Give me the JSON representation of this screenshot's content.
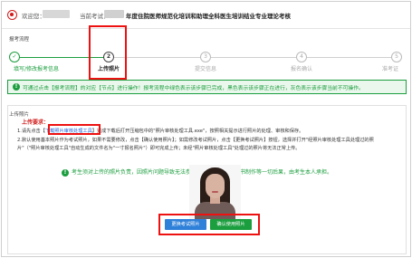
{
  "header": {
    "welcome_label": "欢迎您：",
    "exam_label": "当前考试：",
    "exam_title": "年度住院医师规范化培训和助理全科医生培训结业专业理论考核"
  },
  "process": {
    "section_title": "报考流程",
    "steps": [
      {
        "number": "✓",
        "label": "填写/修改报考信息",
        "state": "done"
      },
      {
        "number": "2",
        "label": "上传照片",
        "state": "active"
      },
      {
        "number": "3",
        "label": "提交信息",
        "state": "pending"
      },
      {
        "number": "4",
        "label": "报名确认",
        "state": "pending"
      },
      {
        "number": "5",
        "label": "准考证",
        "state": "pending"
      }
    ],
    "notice_icon": "info-icon",
    "notice": "可通过点击【报考流程】的对应【节点】进行操作！报考流程中绿色表示该步骤已完成，黑色表示该步骤正在进行，灰色表示该步骤当前不可操作。"
  },
  "upload": {
    "section_title": "上传照片",
    "req_title": "上传要求：",
    "line1_prefix": "1.请先点击【",
    "line1_link": "下载照片审核处理工具",
    "line1_suffix": "】完成下载后打开压缩包中的\"照片审核处理工具.exe\"，按照相关提示进行照片的处理、审核和保存。",
    "line2": "2.默认使用基本照片作为考试照片，如果不需要修改，点击【确认使用照片】；如需修改考试照片，点击【更换考试照片】按钮，选择并打开\"经照片审核处理工具处理过的照",
    "line3": "片\"（\"照片审核处理工具\"自动生成的文件名为\"一寸报名照片\"）即可完成上传；未经\"照片审核处理工具\"处理过的照片将无法正常上传。",
    "warning": "考生须对上传的照片负责，因照片问题导致无法参加考试，影响合格证书制作等一切后果，由考生本人承担。",
    "change_button": "更换考试照片",
    "confirm_button": "确认使用照片"
  },
  "colors": {
    "accent": "#1b9e3e",
    "highlight": "#e11111",
    "link": "#1f5fd6",
    "button_blue": "#2f80d9"
  }
}
